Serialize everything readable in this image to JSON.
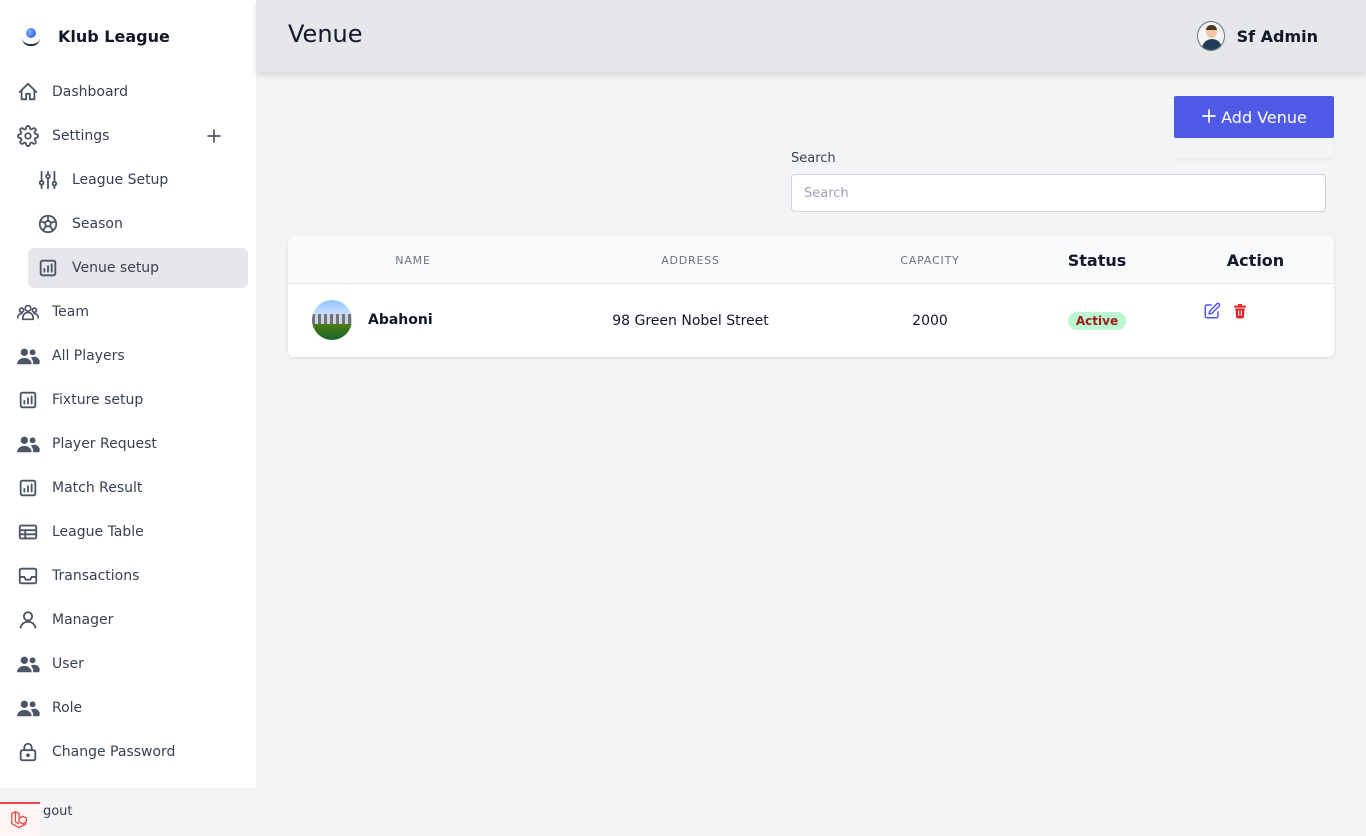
{
  "brand": {
    "name": "Klub League"
  },
  "sidebar": {
    "items": [
      {
        "label": "Dashboard"
      },
      {
        "label": "Settings"
      },
      {
        "label": "League Setup"
      },
      {
        "label": "Season"
      },
      {
        "label": "Venue setup"
      },
      {
        "label": "Team"
      },
      {
        "label": "All Players"
      },
      {
        "label": "Fixture setup"
      },
      {
        "label": "Player Request"
      },
      {
        "label": "Match Result"
      },
      {
        "label": "League Table"
      },
      {
        "label": "Transactions"
      },
      {
        "label": "Manager"
      },
      {
        "label": "User"
      },
      {
        "label": "Role"
      },
      {
        "label": "Change Password"
      }
    ],
    "logout_label": "Logout"
  },
  "header": {
    "title": "Venue",
    "user_name": "Sf Admin"
  },
  "toolbar": {
    "add_label": "Add Venue"
  },
  "search": {
    "label": "Search",
    "placeholder": "Search",
    "value": ""
  },
  "table": {
    "columns": [
      "Name",
      "Address",
      "Capacity",
      "Status",
      "Action"
    ],
    "rows": [
      {
        "name": "Abahoni",
        "address": "98 Green Nobel Street",
        "capacity": "2000",
        "status": "Active"
      }
    ]
  },
  "colors": {
    "accent": "#4f5ae6",
    "active_bg": "#e5e7eb",
    "status_bg": "#bbf7d0",
    "status_text": "#991b1b",
    "edit_icon": "#4f5ae6",
    "delete_icon": "#dc2626"
  }
}
